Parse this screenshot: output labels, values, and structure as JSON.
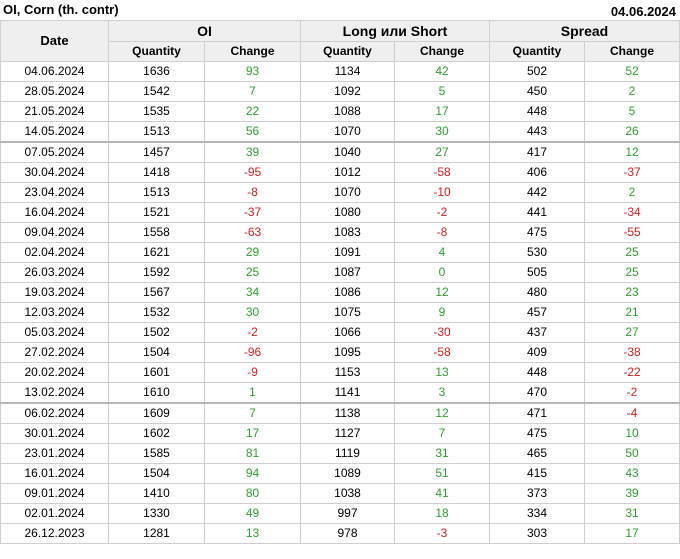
{
  "header": {
    "title": "OI, Corn (th. contr)",
    "date": "04.06.2024"
  },
  "table": {
    "date_label": "Date",
    "groups": [
      "OI",
      "Long или Short",
      "Spread"
    ],
    "sub_headers": [
      "Quantity",
      "Change",
      "Quantity",
      "Change",
      "Quantity",
      "Change"
    ],
    "rows": [
      {
        "date": "04.06.2024",
        "oi_qty": "1636",
        "oi_chg": "93",
        "ls_qty": "1134",
        "ls_chg": "42",
        "sp_qty": "502",
        "sp_chg": "52"
      },
      {
        "date": "28.05.2024",
        "oi_qty": "1542",
        "oi_chg": "7",
        "ls_qty": "1092",
        "ls_chg": "5",
        "sp_qty": "450",
        "sp_chg": "2"
      },
      {
        "date": "21.05.2024",
        "oi_qty": "1535",
        "oi_chg": "22",
        "ls_qty": "1088",
        "ls_chg": "17",
        "sp_qty": "448",
        "sp_chg": "5"
      },
      {
        "date": "14.05.2024",
        "oi_qty": "1513",
        "oi_chg": "56",
        "ls_qty": "1070",
        "ls_chg": "30",
        "sp_qty": "443",
        "sp_chg": "26"
      },
      {
        "date": "07.05.2024",
        "oi_qty": "1457",
        "oi_chg": "39",
        "ls_qty": "1040",
        "ls_chg": "27",
        "sp_qty": "417",
        "sp_chg": "12"
      },
      {
        "date": "30.04.2024",
        "oi_qty": "1418",
        "oi_chg": "-95",
        "ls_qty": "1012",
        "ls_chg": "-58",
        "sp_qty": "406",
        "sp_chg": "-37"
      },
      {
        "date": "23.04.2024",
        "oi_qty": "1513",
        "oi_chg": "-8",
        "ls_qty": "1070",
        "ls_chg": "-10",
        "sp_qty": "442",
        "sp_chg": "2"
      },
      {
        "date": "16.04.2024",
        "oi_qty": "1521",
        "oi_chg": "-37",
        "ls_qty": "1080",
        "ls_chg": "-2",
        "sp_qty": "441",
        "sp_chg": "-34"
      },
      {
        "date": "09.04.2024",
        "oi_qty": "1558",
        "oi_chg": "-63",
        "ls_qty": "1083",
        "ls_chg": "-8",
        "sp_qty": "475",
        "sp_chg": "-55"
      },
      {
        "date": "02.04.2024",
        "oi_qty": "1621",
        "oi_chg": "29",
        "ls_qty": "1091",
        "ls_chg": "4",
        "sp_qty": "530",
        "sp_chg": "25"
      },
      {
        "date": "26.03.2024",
        "oi_qty": "1592",
        "oi_chg": "25",
        "ls_qty": "1087",
        "ls_chg": "0",
        "sp_qty": "505",
        "sp_chg": "25"
      },
      {
        "date": "19.03.2024",
        "oi_qty": "1567",
        "oi_chg": "34",
        "ls_qty": "1086",
        "ls_chg": "12",
        "sp_qty": "480",
        "sp_chg": "23"
      },
      {
        "date": "12.03.2024",
        "oi_qty": "1532",
        "oi_chg": "30",
        "ls_qty": "1075",
        "ls_chg": "9",
        "sp_qty": "457",
        "sp_chg": "21"
      },
      {
        "date": "05.03.2024",
        "oi_qty": "1502",
        "oi_chg": "-2",
        "ls_qty": "1066",
        "ls_chg": "-30",
        "sp_qty": "437",
        "sp_chg": "27"
      },
      {
        "date": "27.02.2024",
        "oi_qty": "1504",
        "oi_chg": "-96",
        "ls_qty": "1095",
        "ls_chg": "-58",
        "sp_qty": "409",
        "sp_chg": "-38"
      },
      {
        "date": "20.02.2024",
        "oi_qty": "1601",
        "oi_chg": "-9",
        "ls_qty": "1153",
        "ls_chg": "13",
        "sp_qty": "448",
        "sp_chg": "-22"
      },
      {
        "date": "13.02.2024",
        "oi_qty": "1610",
        "oi_chg": "1",
        "ls_qty": "1141",
        "ls_chg": "3",
        "sp_qty": "470",
        "sp_chg": "-2"
      },
      {
        "date": "06.02.2024",
        "oi_qty": "1609",
        "oi_chg": "7",
        "ls_qty": "1138",
        "ls_chg": "12",
        "sp_qty": "471",
        "sp_chg": "-4"
      },
      {
        "date": "30.01.2024",
        "oi_qty": "1602",
        "oi_chg": "17",
        "ls_qty": "1127",
        "ls_chg": "7",
        "sp_qty": "475",
        "sp_chg": "10"
      },
      {
        "date": "23.01.2024",
        "oi_qty": "1585",
        "oi_chg": "81",
        "ls_qty": "1119",
        "ls_chg": "31",
        "sp_qty": "465",
        "sp_chg": "50"
      },
      {
        "date": "16.01.2024",
        "oi_qty": "1504",
        "oi_chg": "94",
        "ls_qty": "1089",
        "ls_chg": "51",
        "sp_qty": "415",
        "sp_chg": "43"
      },
      {
        "date": "09.01.2024",
        "oi_qty": "1410",
        "oi_chg": "80",
        "ls_qty": "1038",
        "ls_chg": "41",
        "sp_qty": "373",
        "sp_chg": "39"
      },
      {
        "date": "02.01.2024",
        "oi_qty": "1330",
        "oi_chg": "49",
        "ls_qty": "997",
        "ls_chg": "18",
        "sp_qty": "334",
        "sp_chg": "31"
      },
      {
        "date": "26.12.2023",
        "oi_qty": "1281",
        "oi_chg": "13",
        "ls_qty": "978",
        "ls_chg": "-3",
        "sp_qty": "303",
        "sp_chg": "17"
      }
    ]
  },
  "colors": {
    "positive": "#2ea02e",
    "negative": "#d62020",
    "header_bg": "#efefef",
    "grid": "#cfcfcf"
  }
}
